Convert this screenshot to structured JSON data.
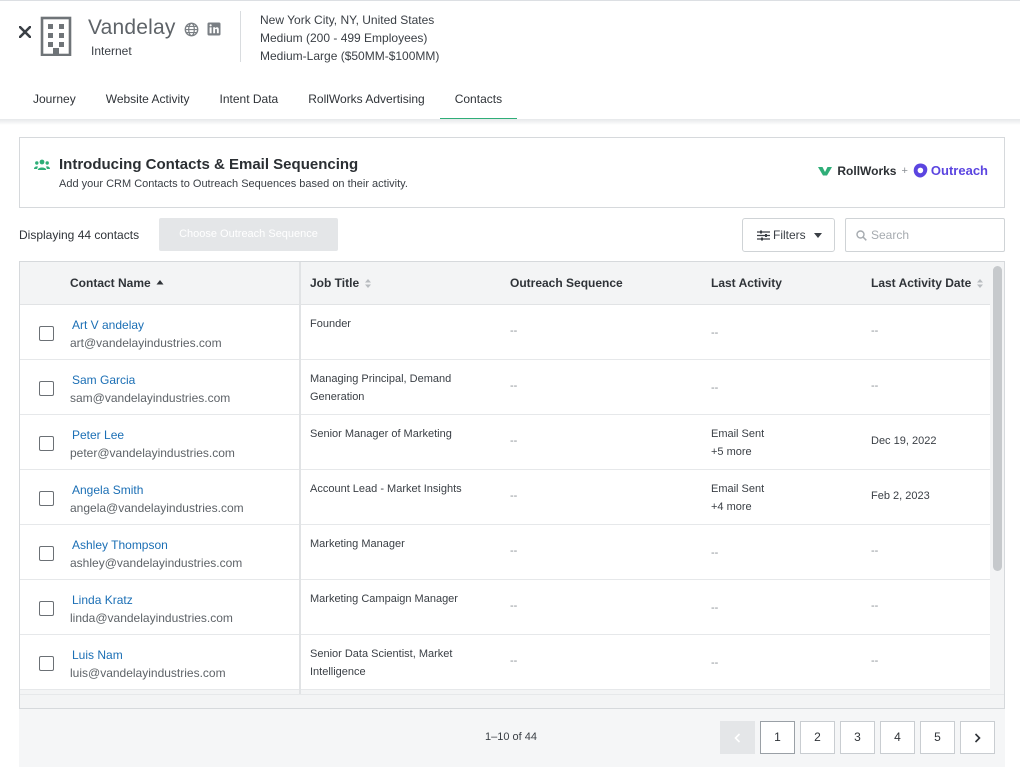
{
  "company": {
    "name": "Vandelay",
    "industry": "Internet",
    "location": "New York City, NY, United States",
    "employees": "Medium (200 - 499 Employees)",
    "revenue": "Medium-Large ($50MM-$100MM)"
  },
  "tabs": [
    {
      "label": "Journey"
    },
    {
      "label": "Website Activity"
    },
    {
      "label": "Intent Data"
    },
    {
      "label": "RollWorks Advertising"
    },
    {
      "label": "Contacts",
      "active": true
    }
  ],
  "banner": {
    "title": "Introducing Contacts & Email Sequencing",
    "subtitle": "Add your CRM Contacts to Outreach Sequences based on their activity.",
    "brand_left": "RollWorks",
    "brand_plus": "+",
    "brand_right": "Outreach"
  },
  "toolbar": {
    "displaying": "Displaying 44 contacts",
    "choose_label": "Choose Outreach Sequence",
    "filters_label": "Filters",
    "search_placeholder": "Search"
  },
  "table": {
    "columns": {
      "name": "Contact Name",
      "job": "Job Title",
      "sequence": "Outreach Sequence",
      "activity": "Last Activity",
      "date": "Last Activity Date"
    },
    "rows": [
      {
        "name": "Art V andelay",
        "email": "art@vandelayindustries.com",
        "job": "Founder",
        "sequence": "--",
        "activity": "--",
        "activity_more": "",
        "date": "--"
      },
      {
        "name": "Sam Garcia",
        "email": "sam@vandelayindustries.com",
        "job": "Managing Principal, Demand Generation",
        "sequence": "--",
        "activity": "--",
        "activity_more": "",
        "date": "--"
      },
      {
        "name": "Peter Lee",
        "email": "peter@vandelayindustries.com",
        "job": "Senior Manager of Marketing",
        "sequence": "--",
        "activity": "Email Sent",
        "activity_more": "+5 more",
        "date": "Dec 19, 2022"
      },
      {
        "name": "Angela Smith",
        "email": "angela@vandelayindustries.com",
        "job": "Account Lead - Market Insights",
        "sequence": "--",
        "activity": "Email Sent",
        "activity_more": "+4 more",
        "date": "Feb 2, 2023"
      },
      {
        "name": "Ashley Thompson",
        "email": "ashley@vandelayindustries.com",
        "job": "Marketing Manager",
        "sequence": "--",
        "activity": "--",
        "activity_more": "",
        "date": "--"
      },
      {
        "name": "Linda Kratz",
        "email": "linda@vandelayindustries.com",
        "job": "Marketing Campaign Manager",
        "sequence": "--",
        "activity": "--",
        "activity_more": "",
        "date": "--"
      },
      {
        "name": "Luis Nam",
        "email": "luis@vandelayindustries.com",
        "job": "Senior Data Scientist, Market Intelligence",
        "sequence": "--",
        "activity": "--",
        "activity_more": "",
        "date": "--"
      }
    ]
  },
  "pagination": {
    "range": "1–10 of 44",
    "pages": [
      "1",
      "2",
      "3",
      "4",
      "5"
    ],
    "current": "1"
  },
  "colors": {
    "accent_green": "#2fae78",
    "link_blue": "#1b6fb5",
    "outreach_purple": "#5b45e0"
  }
}
